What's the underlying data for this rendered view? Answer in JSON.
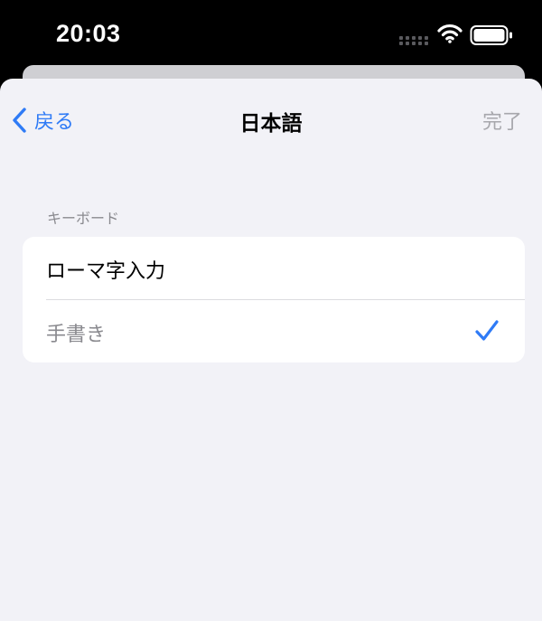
{
  "status_bar": {
    "time": "20:03",
    "icons": [
      "cellular-icon",
      "wifi-icon",
      "battery-icon"
    ]
  },
  "nav": {
    "back_label": "戻る",
    "title": "日本語",
    "done_label": "完了"
  },
  "keyboards": {
    "section_header": "キーボード",
    "items": [
      {
        "label": "ローマ字入力",
        "checked": false
      },
      {
        "label": "手書き",
        "checked": true
      }
    ]
  },
  "colors": {
    "accent": "#2f7bf6",
    "disabled_text": "#a7a7ac",
    "secondary_text": "#8a8a8f",
    "background": "#f2f2f7"
  }
}
